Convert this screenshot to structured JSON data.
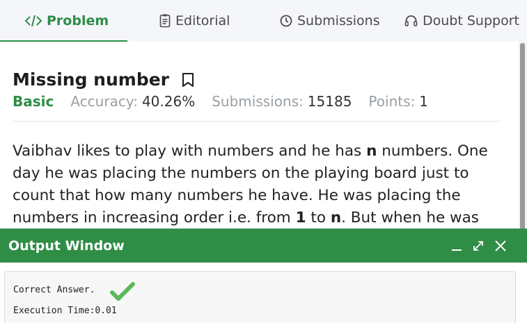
{
  "tabs": [
    {
      "label": "Problem",
      "icon": "code-icon",
      "active": true
    },
    {
      "label": "Editorial",
      "icon": "document-icon",
      "active": false
    },
    {
      "label": "Submissions",
      "icon": "clock-icon",
      "active": false
    },
    {
      "label": "Doubt Support",
      "icon": "headset-icon",
      "active": false
    }
  ],
  "problem": {
    "title": "Missing number",
    "level": "Basic",
    "accuracy_label": "Accuracy:",
    "accuracy_value": "40.26%",
    "submissions_label": "Submissions:",
    "submissions_value": "15185",
    "points_label": "Points:",
    "points_value": "1"
  },
  "description": {
    "p1": "Vaibhav likes to play with numbers and he has ",
    "n1": "n",
    "p2": " numbers. One day he was placing the numbers on the playing board just to count that how many numbers he have. He was placing the numbers in increasing order i.e. from ",
    "one": "1",
    "p3": " to ",
    "n2": "n",
    "p4": ". But when he was"
  },
  "output": {
    "title": "Output Window",
    "result_text": "Correct Answer.",
    "time_text": "Execution Time:0.01"
  },
  "colors": {
    "accent": "#2f8d46",
    "check": "#5cb85c"
  }
}
